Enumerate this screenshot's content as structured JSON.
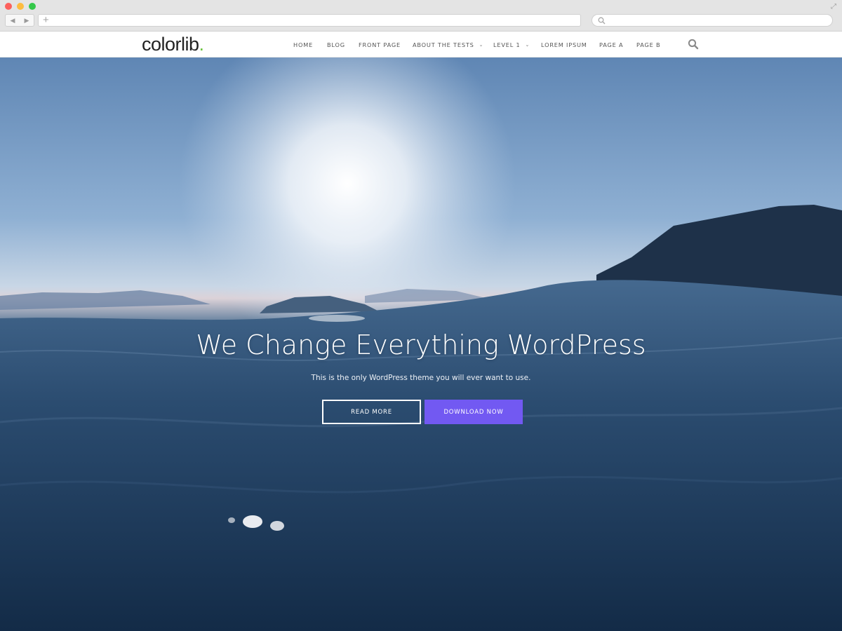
{
  "browser": {
    "back_glyph": "◀",
    "forward_glyph": "▶",
    "new_tab_glyph": "+",
    "search_icon": "search-icon",
    "expand_glyph": "⤢"
  },
  "site": {
    "logo_text": "colorlib",
    "logo_dot": ".",
    "logo_dot_color": "#69c43c",
    "menu": {
      "home": "Home",
      "blog": "Blog",
      "front_page": "Front Page",
      "about_tests": "About The Tests",
      "level1": "Level 1",
      "lorem_ipsum": "Lorem Ipsum",
      "page_a": "Page A",
      "page_b": "Page B",
      "caret": "⌄"
    }
  },
  "hero": {
    "title": "We Change Everything WordPress",
    "subtitle": "This is the only WordPress theme you will ever want to use.",
    "read_more": "Read More",
    "download_now": "Download Now",
    "accent_color": "#7259f2"
  }
}
